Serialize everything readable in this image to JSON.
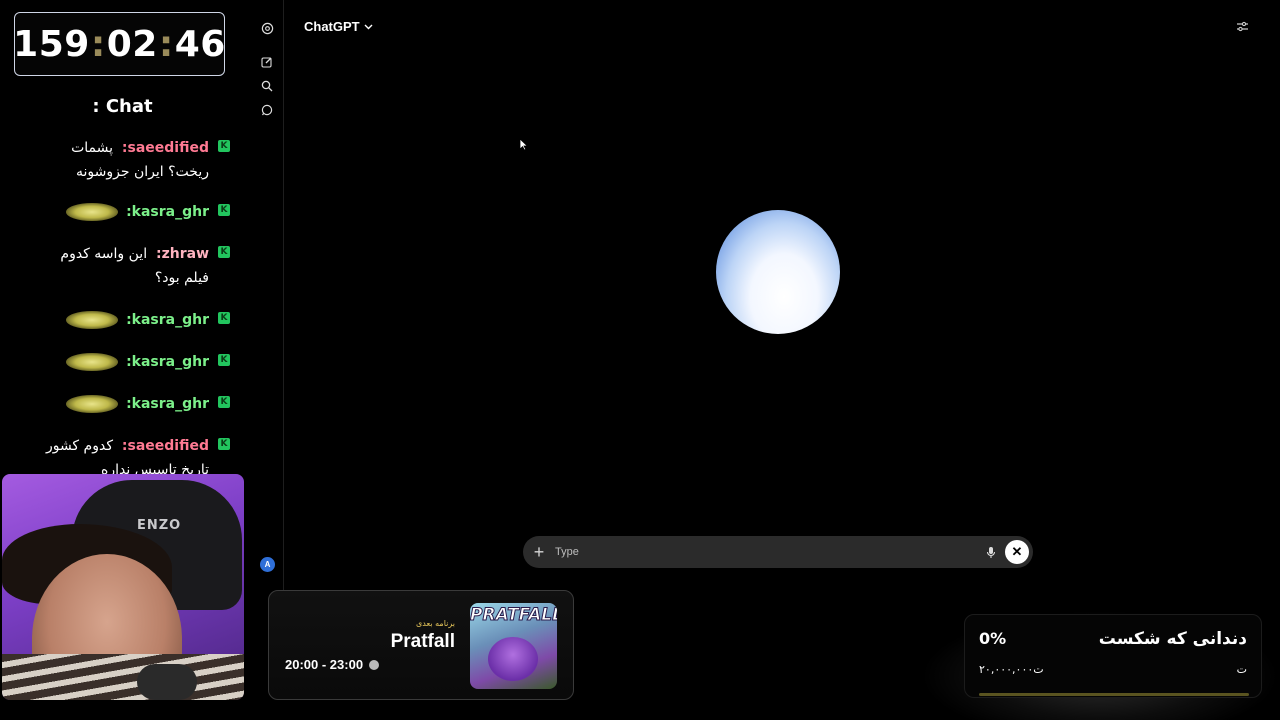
{
  "stream": {
    "timer": {
      "hours": "159",
      "minutes": "02",
      "seconds": "46"
    }
  },
  "chat": {
    "title": ": Chat",
    "messages": [
      {
        "user": ":saeedified",
        "user_color": "#ff7a93",
        "lines": [
          "پشمات",
          "ریخت؟ ایران جزوشونه"
        ]
      },
      {
        "user": ":kasra_ghr",
        "user_color": "#7cf08a",
        "emote": true
      },
      {
        "user": ":zhraw",
        "user_color": "#ffb3c0",
        "lines": [
          "این واسه کدوم",
          "فیلم بود؟"
        ]
      },
      {
        "user": ":kasra_ghr",
        "user_color": "#7cf08a",
        "emote": true
      },
      {
        "user": ":kasra_ghr",
        "user_color": "#7cf08a",
        "emote": true
      },
      {
        "user": ":kasra_ghr",
        "user_color": "#7cf08a",
        "emote": true
      },
      {
        "user": ":saeedified",
        "user_color": "#ff7a93",
        "lines": [
          "کدوم کشور",
          "تاریخ تاسیس نداره"
        ]
      }
    ],
    "badge_label": "K"
  },
  "webcam": {
    "brand_text": "ENZO"
  },
  "chatgpt": {
    "model_label": "ChatGPT",
    "composer_placeholder": "Type",
    "avatar_letter": "A"
  },
  "next_program": {
    "label": "برنامه بعدی",
    "title": "Pratfall",
    "time": "20:00 - 23:00",
    "art_logo": "PRATFALL"
  },
  "goal": {
    "title": "دندانی که شکست",
    "percent_text": "0%",
    "amount": "۲۰,۰۰۰,۰۰۰ت",
    "unit": "ت",
    "progress_fraction": 0.0,
    "accent": "#e7d74a"
  }
}
